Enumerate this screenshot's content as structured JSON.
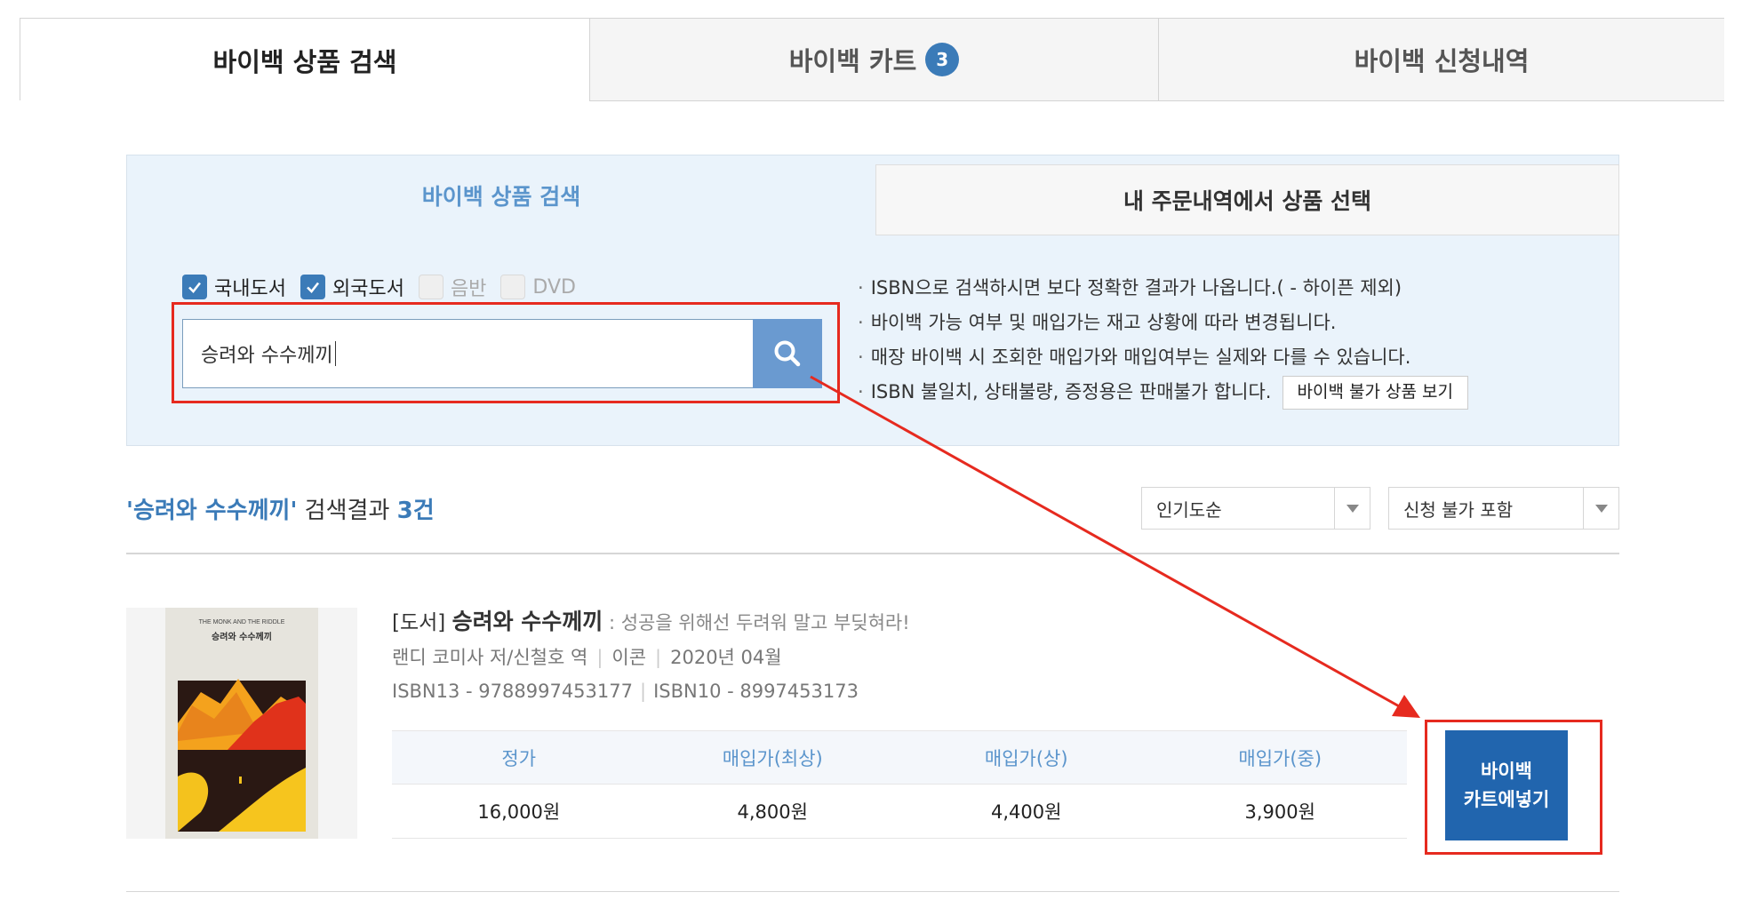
{
  "top_tabs": {
    "search": "바이백 상품 검색",
    "cart": "바이백 카트",
    "cart_count": "3",
    "history": "바이백 신청내역"
  },
  "sub_tabs": {
    "search": "바이백 상품 검색",
    "orders": "내 주문내역에서 상품 선택"
  },
  "filters": [
    {
      "label": "국내도서",
      "checked": true
    },
    {
      "label": "외국도서",
      "checked": true
    },
    {
      "label": "음반",
      "checked": false
    },
    {
      "label": "DVD",
      "checked": false
    }
  ],
  "search": {
    "value": "승려와 수수께끼"
  },
  "notes": [
    "ISBN으로 검색하시면 보다 정확한 결과가 나옵니다.( - 하이픈 제외)",
    "바이백 가능 여부 및 매입가는 재고 상황에 따라 변경됩니다.",
    "매장 바이백 시 조회한 매입가와 매입여부는 실제와 다를 수 있습니다.",
    "ISBN 불일치, 상태불량, 증정용은 판매불가 합니다."
  ],
  "unavailable_button": "바이백 불가 상품 보기",
  "result": {
    "query": "'승려와 수수께끼'",
    "label": " 검색결과 ",
    "count": "3건"
  },
  "sort": {
    "selected": "인기도순"
  },
  "filter_select": {
    "selected": "신청 불가 포함"
  },
  "product": {
    "type": "[도서]",
    "title": "승려와 수수께끼",
    "subtitle": " : 성공을 위해선 두려워 말고 부딪혀라!",
    "author": "랜디 코미사 저/신철호 역",
    "publisher": "이콘",
    "date": "2020년 04월",
    "isbn13": "ISBN13 - 9788997453177",
    "isbn10": "ISBN10 - 8997453173",
    "cover_title_en": "THE MONK AND THE RIDDLE",
    "cover_title_ko": "승려와 수수께끼",
    "price_headers": [
      "정가",
      "매입가(최상)",
      "매입가(상)",
      "매입가(중)"
    ],
    "price_values": [
      "16,000원",
      "4,800원",
      "4,400원",
      "3,900원"
    ]
  },
  "cart_button": {
    "line1": "바이백",
    "line2": "카트에넣기"
  },
  "colors": {
    "accent": "#3b7bb8",
    "cart_button": "#2165ae",
    "annotation": "#e62a1f"
  }
}
